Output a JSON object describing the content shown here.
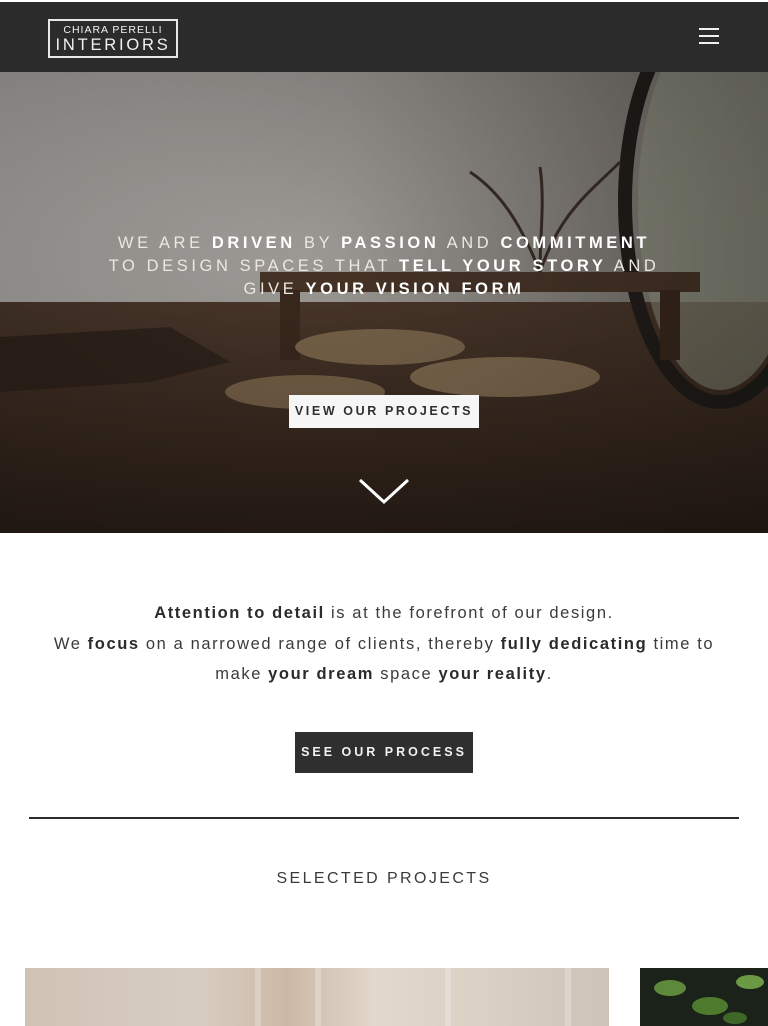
{
  "header": {
    "logo_line1": "CHIARA PERELLI",
    "logo_line2": "INTERIORS",
    "menu_icon": "hamburger-menu-icon"
  },
  "hero": {
    "t1": "WE ARE ",
    "t2": "DRIVEN",
    "t3": " BY ",
    "t4": "PASSION",
    "t5": " AND ",
    "t6": "COMMITMENT",
    "t7": " TO DESIGN SPACES THAT ",
    "t8": "TELL YOUR STORY",
    "t9": " AND GIVE ",
    "t10": "YOUR VISION FORM",
    "button_label": "VIEW OUR PROJECTS",
    "scroll_icon": "chevron-down-icon"
  },
  "intro": {
    "p1": "Attention to detail",
    "p2": " is at the forefront of our design.",
    "p3": "We ",
    "p4": "focus",
    "p5": " on a narrowed range of clients, thereby ",
    "p6": "fully dedicating",
    "p7": " time to make ",
    "p8": "your dream",
    "p9": " space ",
    "p10": "your reality",
    "p11": ".",
    "button_label": "SEE OUR PROCESS"
  },
  "projects": {
    "title": "SELECTED PROJECTS"
  },
  "colors": {
    "header_bg": "#2b2b2b",
    "button_dark": "#2f2f2f",
    "text": "#3a3a3a"
  }
}
